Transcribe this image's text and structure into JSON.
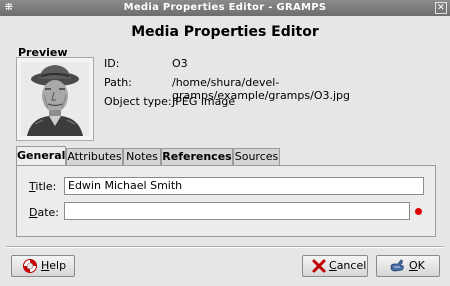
{
  "window": {
    "title": "Media Properties Editor - GRAMPS",
    "menu_glyph": "⁜",
    "close_glyph": "✕"
  },
  "heading": "Media Properties Editor",
  "preview": {
    "label": "Preview"
  },
  "info": {
    "id_label": "ID:",
    "id_value": "O3",
    "path_label": "Path:",
    "path_value": "/home/shura/devel-gramps/example/gramps/O3.jpg",
    "type_label": "Object type:",
    "type_value": "JPEG image"
  },
  "tabs": [
    {
      "label": "General",
      "active": true
    },
    {
      "label": "Attributes",
      "active": false
    },
    {
      "label": "Notes",
      "active": false
    },
    {
      "label": "References",
      "active": false
    },
    {
      "label": "Sources",
      "active": false
    }
  ],
  "general": {
    "title_label": "Title:",
    "title_underline": "T",
    "title_rest": "itle:",
    "title_value": "Edwin Michael Smith",
    "date_label": "Date:",
    "date_underline": "D",
    "date_rest": "ate:",
    "date_value": "",
    "date_status_color": "#dd0000"
  },
  "buttons": {
    "help": {
      "label": "Help",
      "underline": "H",
      "rest": "elp",
      "icon": "lifebuoy-icon"
    },
    "cancel": {
      "label": "Cancel",
      "underline": "C",
      "rest": "ancel",
      "icon": "red-x-icon"
    },
    "ok": {
      "label": "OK",
      "underline": "O",
      "rest": "K",
      "icon": "ok-hand-icon"
    }
  }
}
